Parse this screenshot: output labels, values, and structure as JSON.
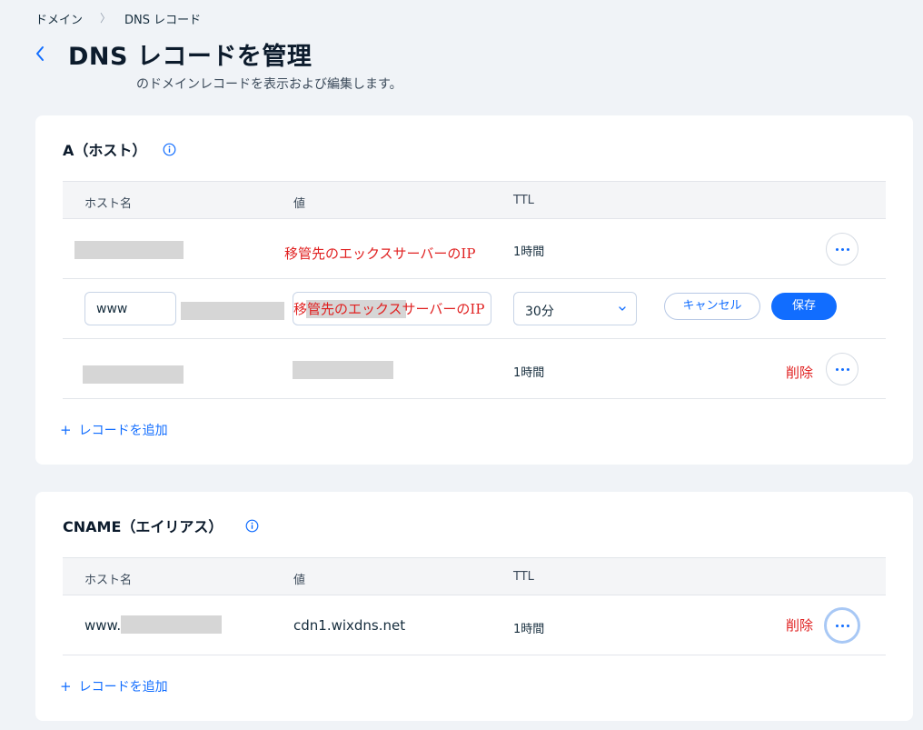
{
  "breadcrumb": {
    "domains": "ドメイン",
    "separator": "〉",
    "current": "DNS レコード"
  },
  "page": {
    "title": "DNS レコードを管理",
    "subtitle": "のドメインレコードを表示および編集します。"
  },
  "table_headers": {
    "host": "ホスト名",
    "value": "値",
    "ttl": "TTL"
  },
  "a_section": {
    "title": "A（ホスト）",
    "rows": [
      {
        "value_annotation": "移管先のエックスサーバーのIP",
        "ttl": "1時間"
      },
      {
        "host_input": "www",
        "value_annotation": "移管先のエックスサーバーのIP",
        "ttl_select": "30分",
        "cancel_label": "キャンセル",
        "save_label": "保存"
      },
      {
        "ttl": "1時間",
        "delete_annotation": "削除"
      }
    ],
    "add_label": "レコードを追加"
  },
  "cname_section": {
    "title": "CNAME（エイリアス）",
    "rows": [
      {
        "host_prefix": "www.",
        "value": "cdn1.wixdns.net",
        "ttl": "1時間",
        "delete_annotation": "削除"
      }
    ],
    "add_label": "レコードを追加"
  },
  "colors": {
    "accent": "#116dff",
    "annotation": "#e02020",
    "background": "#f0f3f7"
  }
}
